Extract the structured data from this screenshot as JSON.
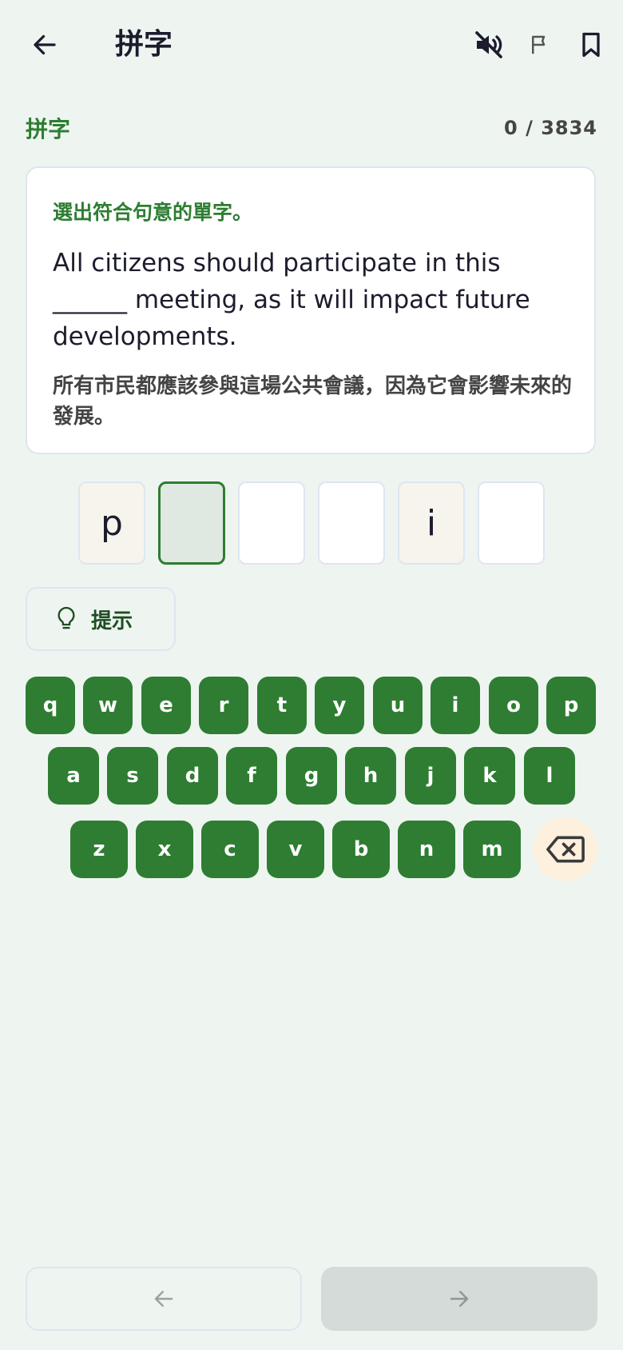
{
  "header": {
    "title": "拼字",
    "back_icon": "arrow-left-icon",
    "sound_icon": "volume-off-icon",
    "flag_icon": "flag-icon",
    "bookmark_icon": "bookmark-icon"
  },
  "section": {
    "label": "拼字",
    "counter": "0 / 3834"
  },
  "card": {
    "instruction": "選出符合句意的單字。",
    "sentence": "All citizens should participate in this ______ meeting, as it will impact future developments.",
    "translation": "所有市民都應該參與這場公共會議，因為它會影響未來的發展。"
  },
  "answer_slots": [
    {
      "letter": "p",
      "state": "filled"
    },
    {
      "letter": "",
      "state": "active"
    },
    {
      "letter": "",
      "state": "empty"
    },
    {
      "letter": "",
      "state": "empty"
    },
    {
      "letter": "i",
      "state": "filled"
    },
    {
      "letter": "",
      "state": "empty"
    }
  ],
  "hint": {
    "label": "提示",
    "icon": "lightbulb-icon"
  },
  "keyboard": {
    "row1": [
      "q",
      "w",
      "e",
      "r",
      "t",
      "y",
      "u",
      "i",
      "o",
      "p"
    ],
    "row2": [
      "a",
      "s",
      "d",
      "f",
      "g",
      "h",
      "j",
      "k",
      "l"
    ],
    "row3": [
      "z",
      "x",
      "c",
      "v",
      "b",
      "n",
      "m"
    ],
    "backspace_icon": "backspace-icon"
  },
  "navigation": {
    "prev_icon": "arrow-left-icon",
    "next_icon": "arrow-right-icon"
  },
  "colors": {
    "accent": "#2e7d32",
    "background": "#eef5f1",
    "backspace_bg": "#fdf0dc"
  }
}
